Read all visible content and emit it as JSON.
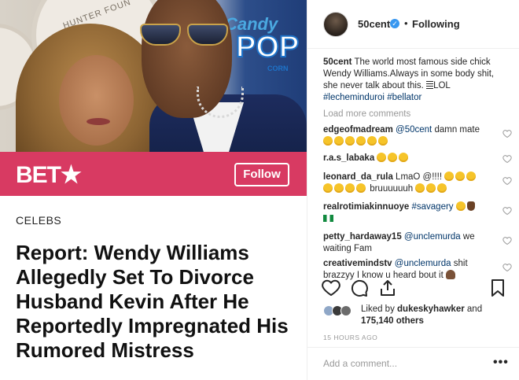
{
  "post_image": {
    "bet_logo": "BET★",
    "follow_label": "Follow",
    "category": "CELEBS",
    "headline": "Report: Wendy Williams Allegedly Set To Divorce Husband Kevin After He Reportedly Impregnated His Rumored Mistress",
    "background_text": {
      "candy": "Candy",
      "pop": "POP",
      "popcorn": "CORN",
      "seal": "HUNTER FOUN"
    }
  },
  "header": {
    "username": "50cent",
    "verified_icon": "verified-badge-icon",
    "separator": "•",
    "follow_state": "Following"
  },
  "caption": {
    "username": "50cent",
    "text": "The world most famous side chick Wendy Williams.Always in some body shit, she never talk about this. ",
    "suffix": "LOL",
    "tags": [
      "#lecheminduroi",
      "#bellator"
    ]
  },
  "load_more": "Load more comments",
  "comments": [
    {
      "username": "edgeofmadream",
      "mention": "@50cent",
      "text": " damn mate",
      "emoji_count": 6,
      "emoji_after": ""
    },
    {
      "username": "r.a.s_labaka",
      "mention": "",
      "text": "",
      "emoji_count": 3,
      "emoji_after": ""
    },
    {
      "username": "leonard_da_rula",
      "mention": "",
      "text": "LmaO @!!!! ",
      "emoji_count": 3,
      "extra": "bruuuuuuh",
      "emoji_count2": 3
    },
    {
      "username": "realrotimiakinnuoye",
      "mention": "",
      "text": "#savagery",
      "emoji_count": 2
    },
    {
      "username": "petty_hardaway15",
      "mention": "@unclemurda",
      "text": " we waiting Fam"
    },
    {
      "username": "creativemindstv",
      "mention": "@unclemurda",
      "text": " shit brazzyy I know u heard bout it"
    }
  ],
  "actions": {
    "like_icon": "heart-icon",
    "comment_icon": "comment-icon",
    "share_icon": "share-icon",
    "save_icon": "bookmark-icon"
  },
  "likes": {
    "prefix": "Liked by ",
    "user": "dukeskyhawker",
    "middle": " and",
    "count": "175,140 others"
  },
  "timestamp": "15 HOURS AGO",
  "add_comment": {
    "placeholder": "Add a comment...",
    "more": "•••"
  },
  "colors": {
    "bet_pink": "#d83a62",
    "link_blue": "#003569",
    "verified_blue": "#3897f0",
    "muted": "#999999"
  }
}
